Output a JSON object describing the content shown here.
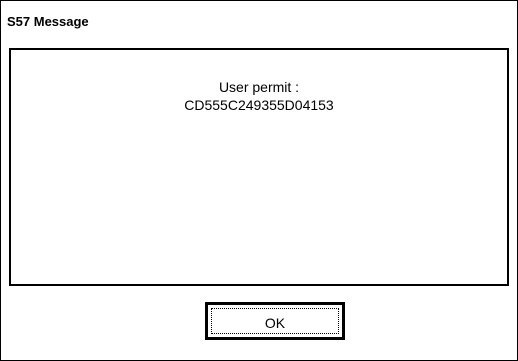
{
  "dialog": {
    "title": "S57 Message",
    "message_label": "User permit :",
    "message_value": "CD555C249355D04153",
    "ok_label": "OK"
  }
}
